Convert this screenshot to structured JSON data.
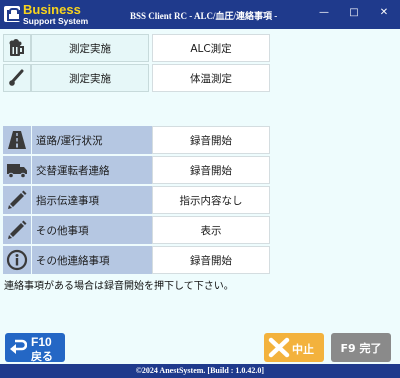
{
  "window": {
    "logo_main": "Business",
    "logo_sub": "Support System",
    "title": "BSS Client RC - ALC/血圧/連絡事項 -",
    "min_glyph": "—",
    "max_glyph": "□",
    "close_glyph": "✕"
  },
  "measurements": [
    {
      "icon": "beer-mug-icon",
      "label": "測定実施",
      "value": "ALC測定"
    },
    {
      "icon": "thermometer-icon",
      "label": "測定実施",
      "value": "体温測定"
    }
  ],
  "items": [
    {
      "icon": "road-icon",
      "label": "道路/運行状況",
      "value": "録音開始"
    },
    {
      "icon": "truck-icon",
      "label": "交替運転者連絡",
      "value": "録音開始"
    },
    {
      "icon": "pencil-icon",
      "label": "指示伝達事項",
      "value": "指示内容なし"
    },
    {
      "icon": "pencil-icon",
      "label": "その他事項",
      "value": "表示"
    },
    {
      "icon": "info-icon",
      "label": "その他連絡事項",
      "value": "録音開始"
    }
  ],
  "message": "連絡事項がある場合は録音開始を押下して下さい。",
  "buttons": {
    "back_key": "F10",
    "back_label": "戻る",
    "stop_label": "中止",
    "done_label": "F9 完了"
  },
  "footer": "©2024 AnestSystem.  [Build : 1.0.42.0]",
  "colors": {
    "titlebar": "#1f3a8c",
    "logo_yellow": "#f7d31e",
    "background": "#eefcfd",
    "label_blue": "#b5c7e2",
    "back_button": "#2467c5",
    "stop_button": "#f3b23d",
    "done_button": "#8a8a8a"
  }
}
